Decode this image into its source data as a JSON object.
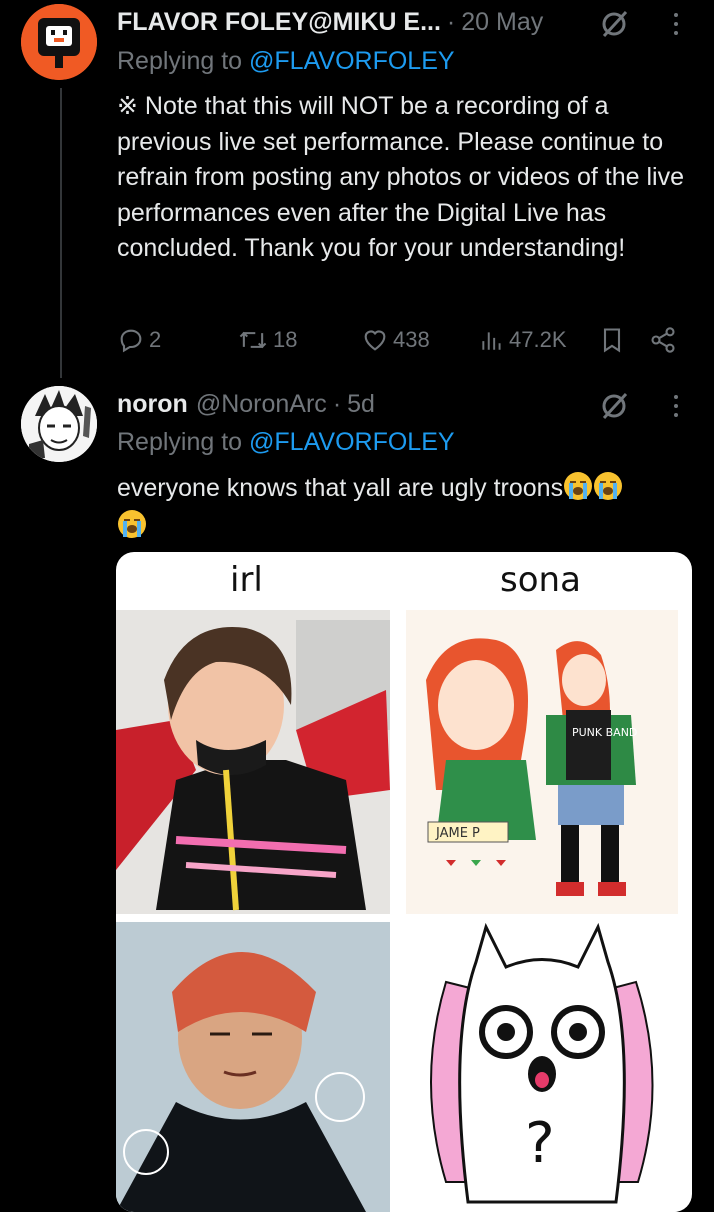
{
  "tweet1": {
    "display_name": "FLAVOR FOLEY@MIKU E...",
    "date": "20 May",
    "replying_prefix": "Replying to",
    "replying_handle": "@FLAVORFOLEY",
    "text": "※ Note that this will NOT be a recording of a previous live set performance. Please continue to refrain from posting any photos or videos of the live performances even after the Digital Live has concluded. Thank you for your understanding!",
    "stats": {
      "replies": "2",
      "reposts": "18",
      "likes": "438",
      "views": "47.2K"
    },
    "colors": {
      "avatar_bg": "#f05a24"
    }
  },
  "tweet2": {
    "display_name": "noron",
    "handle": "@NoronArc",
    "date": "5d",
    "replying_prefix": "Replying to",
    "replying_handle": "@FLAVORFOLEY",
    "text": "everyone knows that yall are ugly troons",
    "emoji": [
      "loudly-crying-face",
      "loudly-crying-face",
      "loudly-crying-face"
    ],
    "media": {
      "label_left": "irl",
      "label_right": "sona",
      "sona_text_shirt": "PUNK BAND",
      "sona_name_tag": "JAME P",
      "mascot_symbol": "?"
    }
  },
  "icons": {
    "grok": "grok-icon",
    "more": "more-icon",
    "reply": "reply-icon",
    "repost": "repost-icon",
    "like": "like-icon",
    "views": "views-icon",
    "bookmark": "bookmark-icon",
    "share": "share-icon"
  },
  "colors": {
    "bg": "#000000",
    "text": "#e7e9ea",
    "muted": "#71767b",
    "link": "#1d9bf0"
  }
}
